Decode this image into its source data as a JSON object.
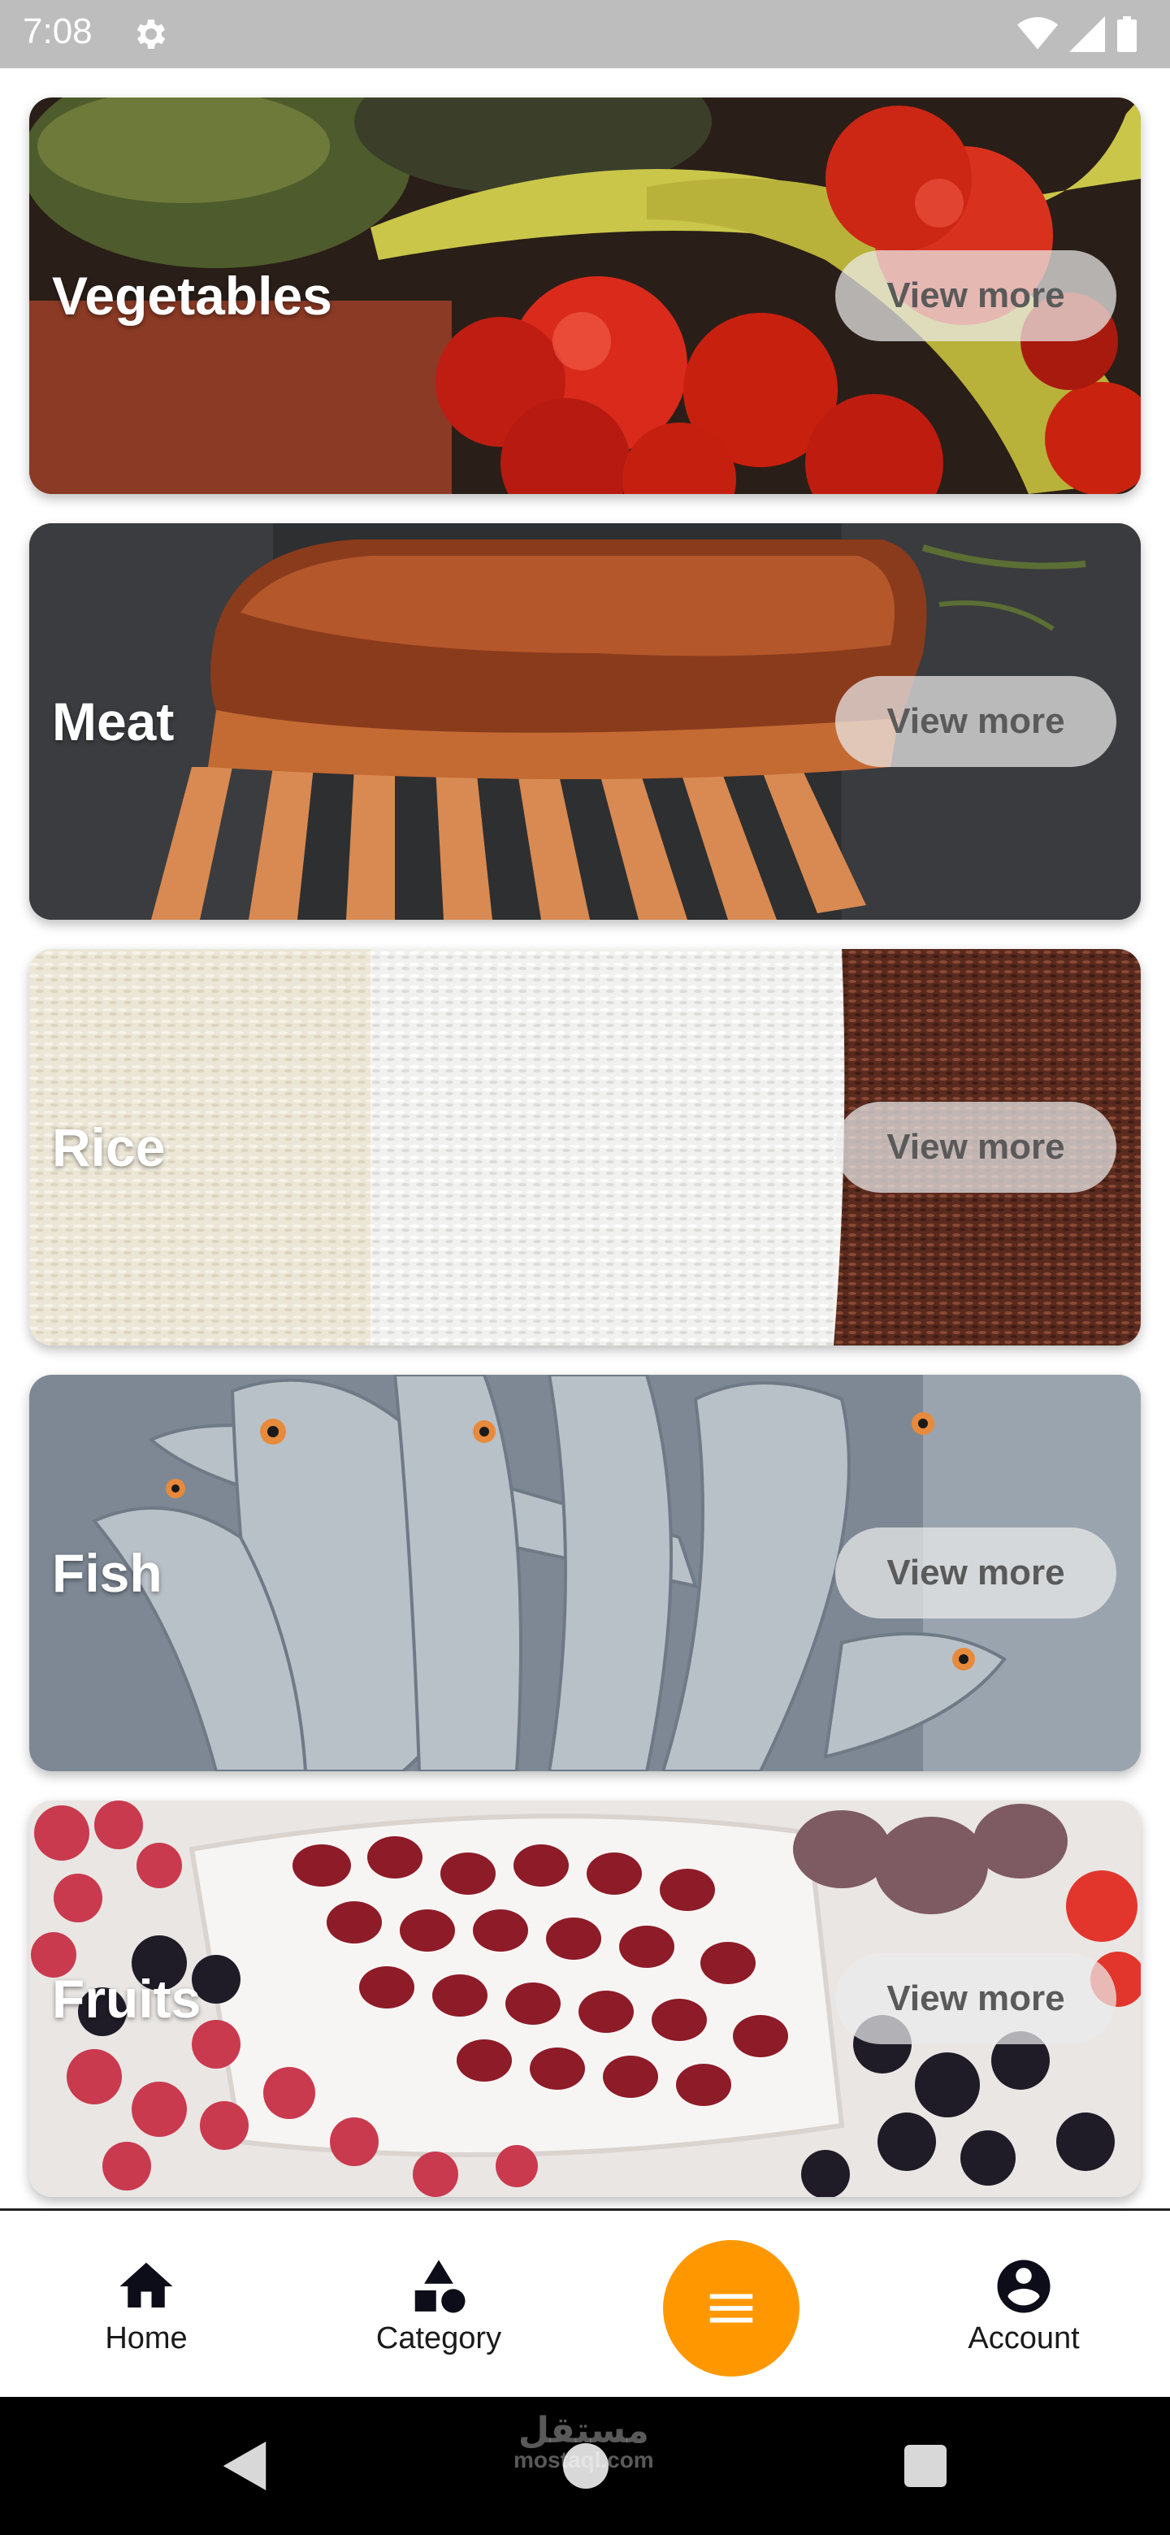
{
  "status_bar": {
    "time": "7:08",
    "icons": [
      "gear-icon",
      "wifi-icon",
      "signal-icon",
      "battery-icon"
    ]
  },
  "categories": [
    {
      "title": "Vegetables",
      "button": "View more"
    },
    {
      "title": "Meat",
      "button": "View more"
    },
    {
      "title": "Rice",
      "button": "View more"
    },
    {
      "title": "Fish",
      "button": "View more"
    },
    {
      "title": "Fruits",
      "button": "View more"
    }
  ],
  "bottom_nav": {
    "home": "Home",
    "category": "Category",
    "menu_icon": "menu-icon",
    "account": "Account"
  },
  "watermark": {
    "logo_text": "مستقل",
    "domain": "mostaql.com"
  },
  "colors": {
    "accent": "#ff9800",
    "status_bar": "#bdbdbd",
    "nav_bar": "#000000"
  }
}
